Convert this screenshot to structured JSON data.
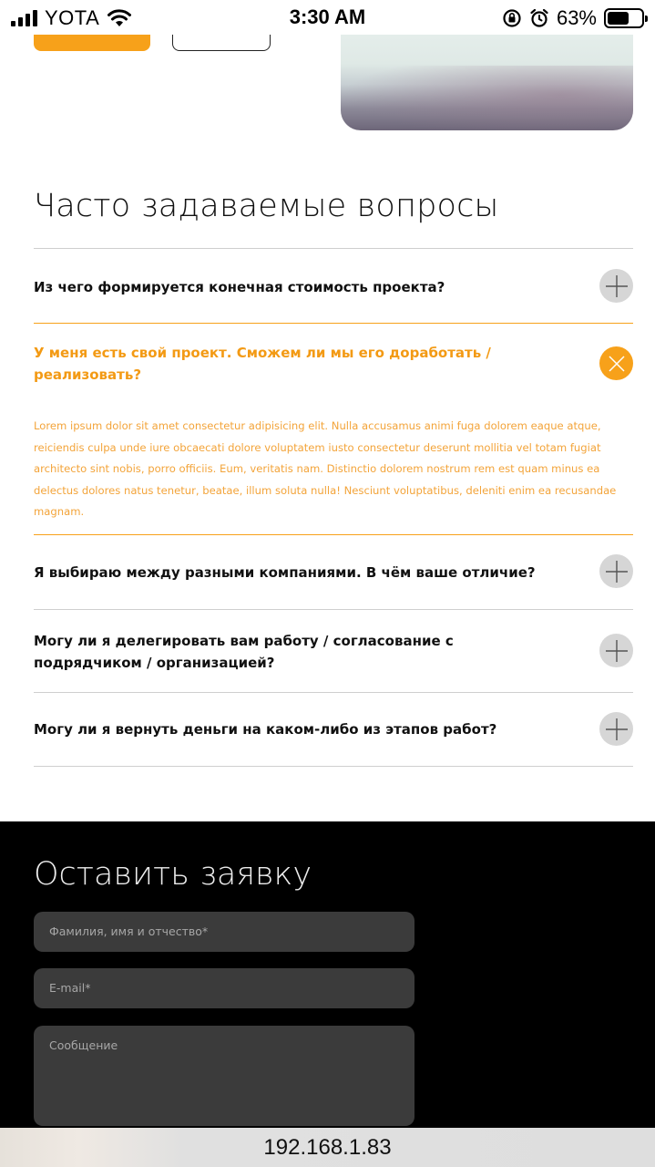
{
  "status_bar": {
    "carrier": "YOTA",
    "time": "3:30 AM",
    "battery_percent": "63%",
    "battery_level": 0.63
  },
  "faq": {
    "title": "Часто задаваемые вопросы",
    "items": [
      {
        "question": "Из чего формируется конечная стоимость проекта?",
        "open": false
      },
      {
        "question": "У меня есть свой проект. Сможем ли мы его доработать / реализовать?",
        "open": true,
        "answer": "Lorem ipsum dolor sit amet consectetur adipisicing elit. Nulla accusamus animi fuga dolorem eaque atque, reiciendis culpa unde iure obcaecati dolore voluptatem iusto consectetur deserunt mollitia vel totam fugiat architecto sint nobis, porro officiis. Eum, veritatis nam. Distinctio dolorem nostrum rem est quam minus ea delectus dolores natus tenetur, beatae, illum soluta nulla! Nesciunt voluptatibus, deleniti enim ea recusandae magnam."
      },
      {
        "question": "Я выбираю между разными компаниями. В чём ваше отличие?",
        "open": false
      },
      {
        "question": "Могу ли я делегировать вам работу / согласование с подрядчиком / организацией?",
        "open": false
      },
      {
        "question": "Могу ли я вернуть деньги на каком-либо из этапов работ?",
        "open": false
      }
    ]
  },
  "form": {
    "title": "Оставить заявку",
    "name_placeholder": "Фамилия, имя и отчество*",
    "email_placeholder": "E-mail*",
    "message_placeholder": "Сообщение"
  },
  "address_bar": {
    "url": "192.168.1.83"
  },
  "colors": {
    "accent": "#f7a11a",
    "toggle_inactive": "#d6d6d6",
    "form_background": "#000000",
    "field_background": "#3b3b3b"
  },
  "icons": {
    "collapsed": "plus-icon",
    "expanded": "close-icon"
  }
}
